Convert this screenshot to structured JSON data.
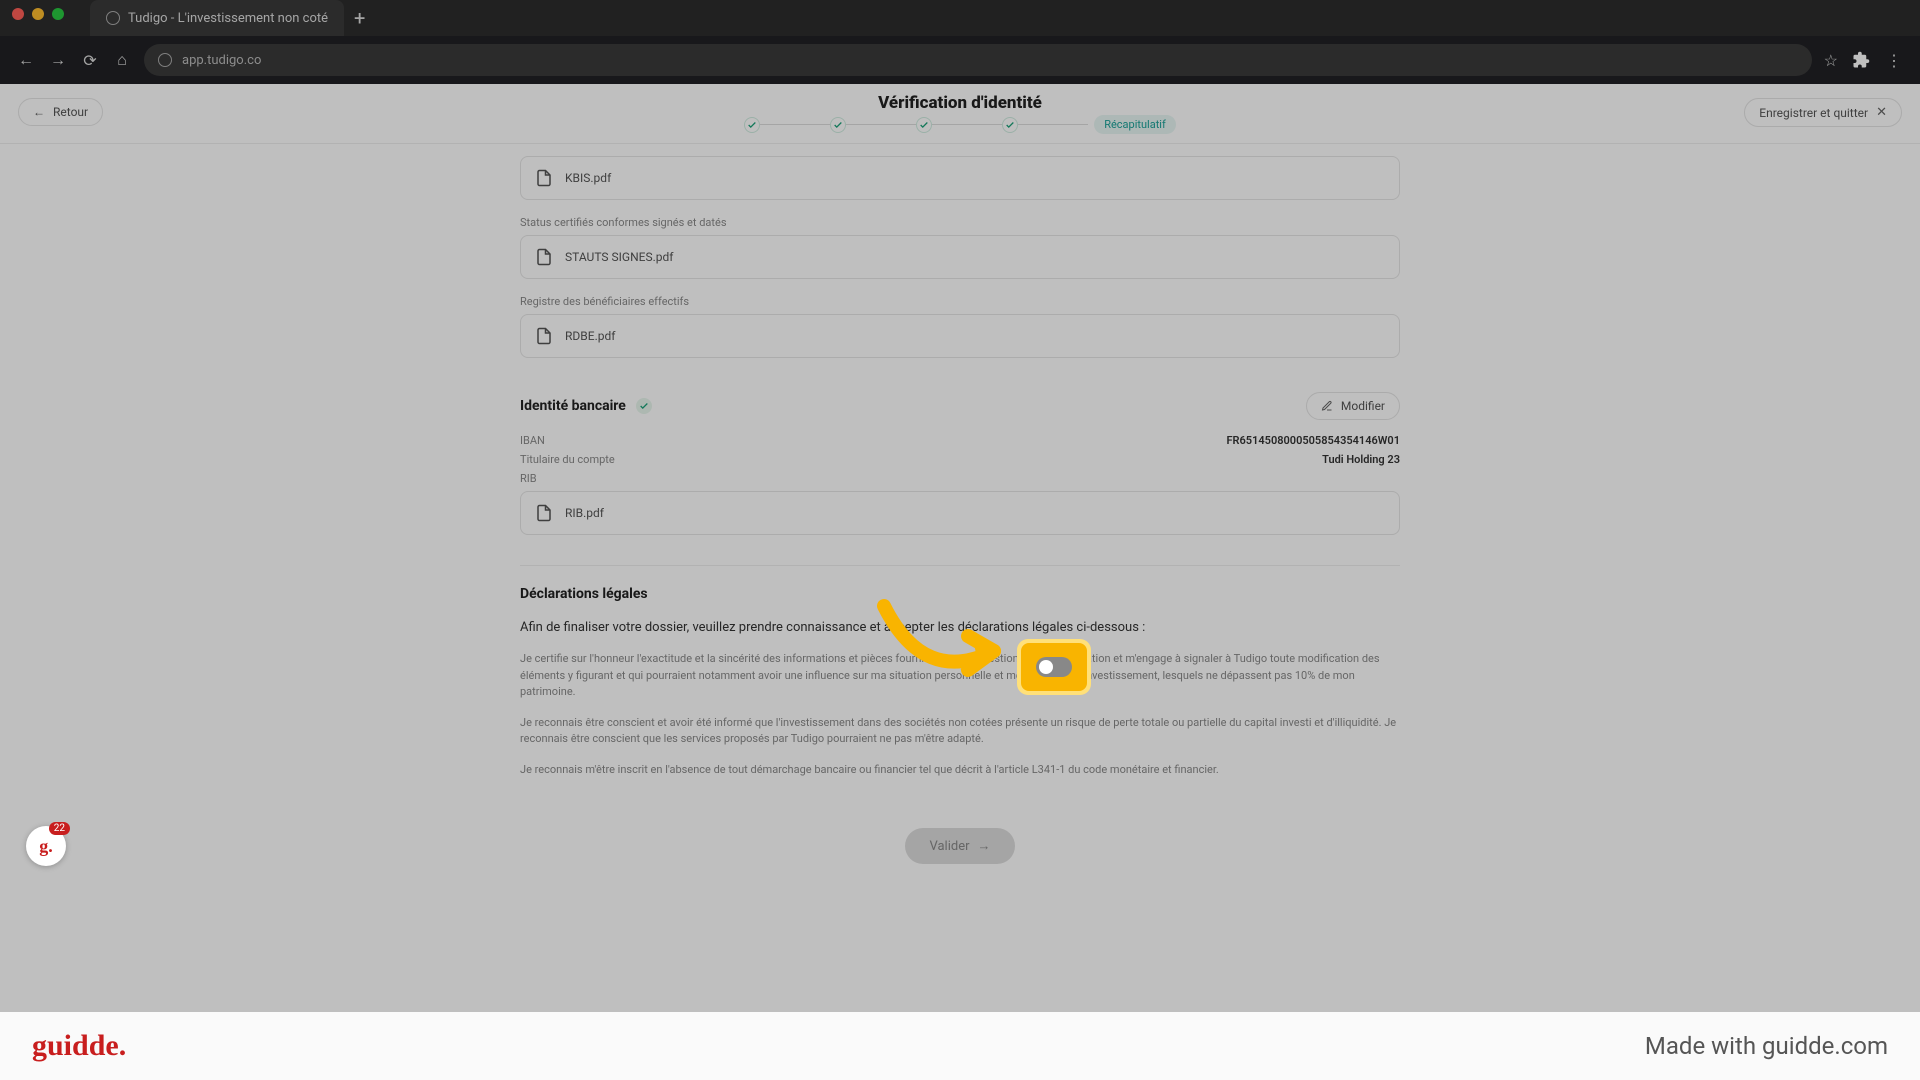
{
  "browser": {
    "tab_title": "Tudigo - L'investissement non coté",
    "url": "app.tudigo.co"
  },
  "header": {
    "title": "Vérification d'identité",
    "back": "Retour",
    "save_quit": "Enregistrer et quitter",
    "step_current": "Récapitulatif"
  },
  "files": {
    "kbis_label": "",
    "kbis": "KBIS.pdf",
    "status_label": "Status certifiés conformes signés et datés",
    "status_file": "STAUTS SIGNES.pdf",
    "rbe_label": "Registre des bénéficiaires effectifs",
    "rbe_file": "RDBE.pdf"
  },
  "bank": {
    "section_title": "Identité bancaire",
    "modify": "Modifier",
    "iban_label": "IBAN",
    "iban_value": "FR6514508000505854354146W01",
    "holder_label": "Titulaire du compte",
    "holder_value": "Tudi Holding 23",
    "rib_label": "RIB",
    "rib_file": "RIB.pdf"
  },
  "declarations": {
    "title": "Déclarations légales",
    "lead": "Afin de finaliser votre dossier, veuillez prendre connaissance et accepter les déclarations légales ci-dessous :",
    "p1": "Je certifie sur l'honneur l'exactitude et la sincérité des informations et pièces fournies dans le questionnaire d'information et m'engage à signaler à Tudigo toute modification des éléments y figurant et qui pourraient notamment avoir une influence sur ma situation personnelle et mes objectifs d'investissement, lesquels ne dépassent pas 10% de mon patrimoine.",
    "p2": "Je reconnais être conscient et avoir été informé que l'investissement dans des sociétés non cotées présente un risque de perte totale ou partielle du capital investi et d'illiquidité. Je reconnais être conscient que les services proposés par Tudigo pourraient ne pas m'être adapté.",
    "p3": "Je reconnais m'être inscrit en l'absence de tout démarchage bancaire ou financier tel que décrit à l'article L341-1 du code monétaire et financier."
  },
  "validate": "Valider",
  "guidde": {
    "count": "22",
    "logo": "guidde.",
    "made_with": "Made with guidde.com"
  }
}
